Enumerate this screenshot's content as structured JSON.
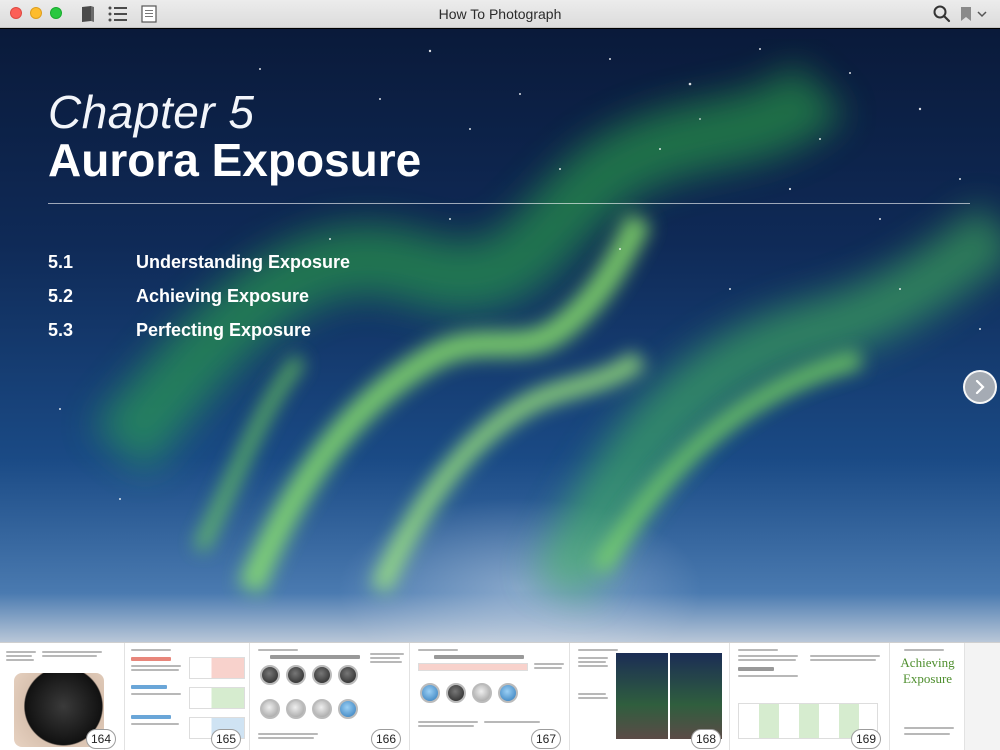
{
  "window": {
    "title": "How To Photograph",
    "icons": [
      "library-icon",
      "toc-list-icon",
      "notes-icon",
      "search-icon",
      "bookmark-icon",
      "chevron-down-icon"
    ]
  },
  "colors": {
    "close": "#fc5f57",
    "minimize": "#fdbc2e",
    "maximize": "#28c840",
    "accent_red": "#e8867b",
    "accent_blue": "#6aa6d8",
    "accent_green": "#4f8f2f"
  },
  "cover": {
    "chapter_label": "Chapter 5",
    "chapter_title": "Aurora Exposure",
    "toc": [
      {
        "num": "5.1",
        "text": "Understanding Exposure"
      },
      {
        "num": "5.2",
        "text": "Achieving Exposure"
      },
      {
        "num": "5.3",
        "text": "Perfecting Exposure"
      }
    ]
  },
  "thumbnails": {
    "pages": [
      "164",
      "165",
      "166",
      "167",
      "168",
      "169"
    ],
    "last_title_line1": "Achieving",
    "last_title_line2": "Exposure"
  }
}
